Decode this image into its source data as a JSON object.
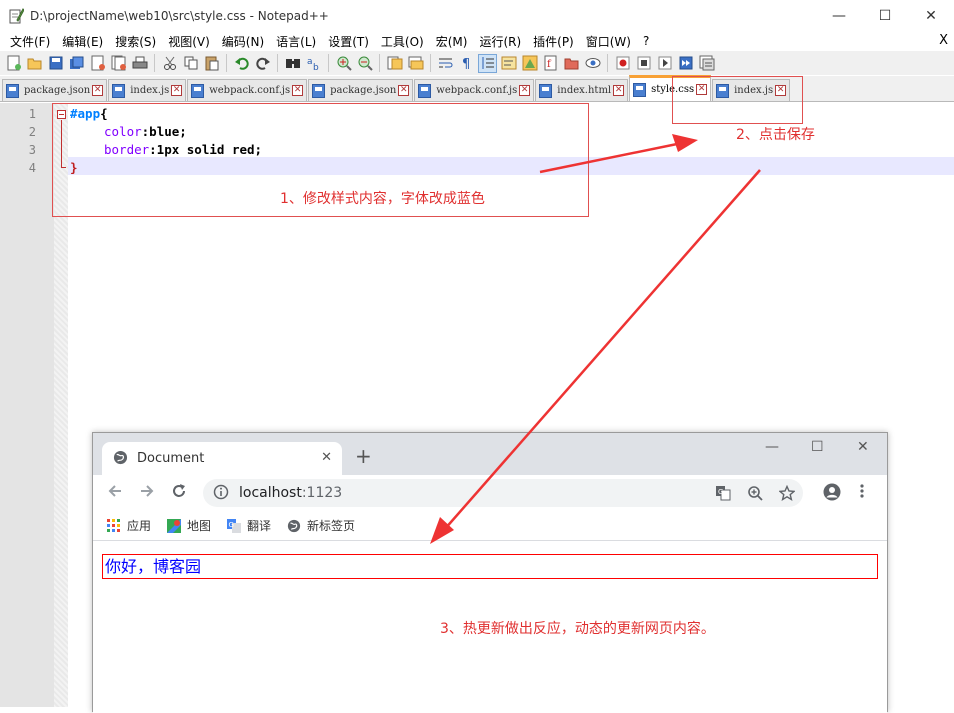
{
  "notepad": {
    "title": "D:\\projectName\\web10\\src\\style.css - Notepad++",
    "window_controls": {
      "minimize": "—",
      "maximize": "☐",
      "close": "✕"
    },
    "menu": [
      "文件(F)",
      "编辑(E)",
      "搜索(S)",
      "视图(V)",
      "编码(N)",
      "语言(L)",
      "设置(T)",
      "工具(O)",
      "宏(M)",
      "运行(R)",
      "插件(P)",
      "窗口(W)",
      "?"
    ],
    "menu_close": "X",
    "tabs": [
      {
        "label": "package.json",
        "active": false
      },
      {
        "label": "index.js",
        "active": false
      },
      {
        "label": "webpack.conf.js",
        "active": false
      },
      {
        "label": "package.json",
        "active": false
      },
      {
        "label": "webpack.conf.js",
        "active": false
      },
      {
        "label": "index.html",
        "active": false
      },
      {
        "label": "style.css",
        "active": true
      },
      {
        "label": "index.js",
        "active": false
      }
    ],
    "editor": {
      "line_numbers": [
        "1",
        "2",
        "3",
        "4"
      ],
      "code": {
        "l1_selector": "#app",
        "l1_brace": "{",
        "l2_prop": "color",
        "l2_val": ":blue;",
        "l3_prop": "border",
        "l3_val": ":1px solid red;",
        "l4_brace": "}"
      }
    }
  },
  "annotations": {
    "step1": "1、修改样式内容，字体改成蓝色",
    "step2": "2、点击保存",
    "step3": "3、热更新做出反应，动态的更新网页内容。",
    "color": "#e03030"
  },
  "browser": {
    "tab_title": "Document",
    "tab_close": "✕",
    "new_tab": "+",
    "window_controls": {
      "minimize": "—",
      "maximize": "☐",
      "close": "✕"
    },
    "url_host": "localhost",
    "url_port": ":1123",
    "bookmarks": [
      "应用",
      "地图",
      "翻译",
      "新标签页"
    ],
    "page_text": "你好，博客园"
  }
}
